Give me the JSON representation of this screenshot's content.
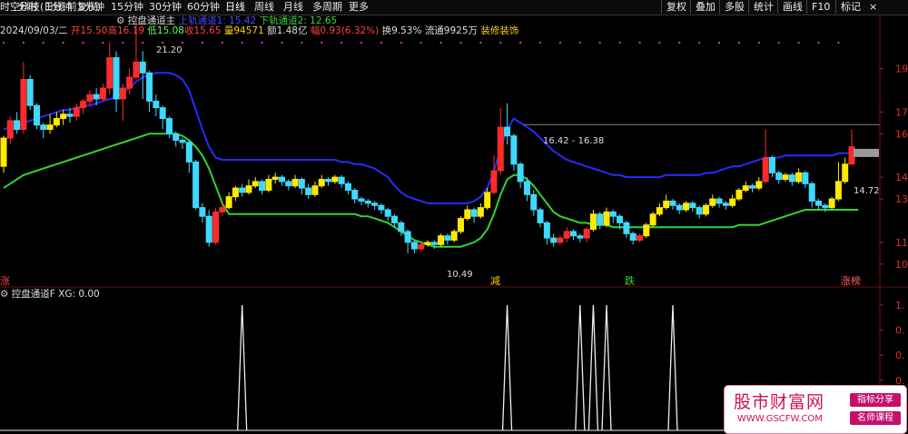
{
  "toolbar": {
    "title_fragment": "时空科技(日线 前复权)",
    "indicator_label": "控盘通道主",
    "periods": [
      "分时",
      "1分钟",
      "5分钟",
      "15分钟",
      "30分钟",
      "60分钟",
      "日线",
      "周线",
      "月线",
      "多周期",
      "更多"
    ],
    "active_period": "日线",
    "right_buttons": [
      "复权",
      "叠加",
      "多股",
      "统计",
      "画线",
      "F10",
      "标记"
    ]
  },
  "header": {
    "upper_channel": "上轨通道1: 15.42",
    "lower_channel": "下轨通道2: 12.65",
    "date": "2024/09/03/二",
    "open": "开15.50",
    "high": "高16.19",
    "low": "低15.08",
    "close": "收15.65",
    "volume": "量94571",
    "amount": "额1.48亿",
    "change": "幅0.93(6.32%)",
    "turnover": "换9.53%",
    "float": "流通9925万",
    "sector": "装修装饰"
  },
  "annotations": {
    "peak": "21.20",
    "trough": "10.49",
    "mid_peak": "16.42 - 16.38",
    "current_price": "14.72",
    "label_jian": "减",
    "label_die": "跌",
    "label_zhangbang": "涨榜",
    "label_left": "涨"
  },
  "price_axis": [
    "19.",
    "17.",
    "16.",
    "14.",
    "13.",
    "11.",
    "10."
  ],
  "sub_panel": {
    "title": "控盘通道F  XG: 0.00",
    "axis": [
      "1.",
      "0.",
      "0.",
      "0.",
      "0.",
      "0."
    ]
  },
  "chart_data": [
    {
      "type": "candlestick",
      "title": "控盘通道主",
      "y_ticks": [
        19,
        17,
        16,
        14,
        13,
        11,
        10
      ],
      "ylim": [
        9.2,
        20.4
      ],
      "grid": false,
      "series": [
        {
          "name": "上轨通道1",
          "values": [
            16.2,
            16.3,
            16.4,
            16.5,
            16.6,
            16.7,
            16.8,
            16.9,
            17.0,
            17.1,
            17.1,
            17.2,
            17.3,
            17.3,
            17.4,
            17.5,
            17.6,
            17.7,
            17.9,
            18.1,
            18.4,
            18.6,
            18.7,
            18.8,
            18.8,
            18.8,
            18.7,
            18.5,
            18.0,
            17.1,
            16.2,
            15.4,
            14.9,
            14.8,
            14.8,
            14.8,
            14.8,
            14.8,
            14.8,
            14.8,
            14.8,
            14.8,
            14.8,
            14.8,
            14.8,
            14.8,
            14.8,
            14.8,
            14.8,
            14.8,
            14.8,
            14.7,
            14.7,
            14.6,
            14.6,
            14.5,
            14.4,
            14.2,
            14.0,
            13.6,
            13.3,
            13.1,
            13.0,
            12.9,
            12.8,
            12.8,
            12.8,
            12.8,
            12.8,
            12.8,
            12.8,
            12.9,
            13.1,
            13.5,
            14.3,
            15.3,
            16.2,
            16.7,
            16.5,
            16.3,
            16.1,
            15.8,
            15.5,
            15.2,
            15.0,
            14.8,
            14.7,
            14.6,
            14.5,
            14.4,
            14.3,
            14.2,
            14.1,
            14.1,
            14.0,
            14.0,
            14.0,
            14.0,
            14.0,
            14.0,
            14.1,
            14.1,
            14.1,
            14.1,
            14.1,
            14.1,
            14.2,
            14.2,
            14.3,
            14.4,
            14.5,
            14.5,
            14.6,
            14.7,
            14.8,
            14.9,
            14.9,
            14.9,
            15.0,
            15.0,
            15.0,
            15.0,
            15.0,
            15.0,
            15.0,
            15.0,
            15.1,
            15.1,
            15.1,
            15.1,
            15.1
          ]
        },
        {
          "name": "下轨通道2",
          "values": [
            13.5,
            13.7,
            13.9,
            14.1,
            14.2,
            14.3,
            14.4,
            14.5,
            14.6,
            14.7,
            14.8,
            14.9,
            15.0,
            15.1,
            15.2,
            15.3,
            15.4,
            15.5,
            15.6,
            15.7,
            15.8,
            15.9,
            16.0,
            16.0,
            16.0,
            16.0,
            16.0,
            15.9,
            15.7,
            15.4,
            15.0,
            14.4,
            13.6,
            12.8,
            12.3,
            12.3,
            12.3,
            12.3,
            12.3,
            12.3,
            12.3,
            12.3,
            12.3,
            12.3,
            12.3,
            12.3,
            12.3,
            12.3,
            12.3,
            12.3,
            12.3,
            12.3,
            12.3,
            12.3,
            12.2,
            12.2,
            12.1,
            12.0,
            11.9,
            11.7,
            11.5,
            11.3,
            11.1,
            11.0,
            10.9,
            10.8,
            10.8,
            10.8,
            10.8,
            10.8,
            10.9,
            11.0,
            11.2,
            11.6,
            12.3,
            13.2,
            13.9,
            14.1,
            14.1,
            13.9,
            13.6,
            13.2,
            12.8,
            12.4,
            12.2,
            12.1,
            12.0,
            11.9,
            11.9,
            11.8,
            11.8,
            11.8,
            11.7,
            11.7,
            11.7,
            11.7,
            11.7,
            11.7,
            11.7,
            11.7,
            11.7,
            11.7,
            11.7,
            11.7,
            11.7,
            11.7,
            11.7,
            11.7,
            11.7,
            11.7,
            11.7,
            11.8,
            11.8,
            11.8,
            11.8,
            11.9,
            12.0,
            12.1,
            12.2,
            12.3,
            12.4,
            12.5,
            12.5,
            12.5,
            12.5,
            12.5,
            12.5,
            12.5,
            12.5,
            12.5
          ]
        }
      ],
      "candles": [
        [
          14.5,
          15.8,
          15.9,
          14.2
        ],
        [
          15.8,
          16.6,
          16.8,
          15.5
        ],
        [
          16.6,
          16.2,
          17.0,
          16.0
        ],
        [
          16.2,
          18.5,
          19.3,
          16.0
        ],
        [
          18.5,
          17.3,
          18.7,
          17.1
        ],
        [
          17.3,
          16.4,
          17.4,
          16.2
        ],
        [
          16.4,
          16.2,
          16.5,
          15.8
        ],
        [
          16.2,
          16.4,
          16.9,
          16.0
        ],
        [
          16.4,
          16.7,
          17.0,
          16.3
        ],
        [
          16.7,
          16.9,
          17.1,
          16.4
        ],
        [
          16.9,
          16.8,
          17.2,
          16.5
        ],
        [
          16.8,
          17.2,
          17.4,
          16.6
        ],
        [
          17.2,
          17.5,
          17.6,
          16.9
        ],
        [
          17.5,
          17.8,
          18.0,
          17.3
        ],
        [
          17.8,
          17.6,
          18.1,
          17.3
        ],
        [
          17.6,
          18.1,
          18.3,
          17.5
        ],
        [
          18.1,
          19.5,
          20.2,
          17.8
        ],
        [
          19.5,
          17.6,
          19.8,
          17.0
        ],
        [
          17.6,
          18.1,
          18.3,
          16.6
        ],
        [
          18.1,
          18.6,
          19.0,
          17.8
        ],
        [
          18.6,
          19.3,
          21.2,
          18.5
        ],
        [
          19.3,
          18.8,
          19.8,
          17.6
        ],
        [
          18.8,
          17.5,
          18.9,
          17.0
        ],
        [
          17.5,
          17.2,
          17.8,
          16.8
        ],
        [
          17.2,
          16.7,
          17.3,
          16.2
        ],
        [
          16.7,
          16.0,
          16.8,
          15.8
        ],
        [
          16.0,
          15.7,
          16.1,
          15.4
        ],
        [
          15.7,
          15.6,
          15.8,
          15.3
        ],
        [
          15.6,
          14.7,
          15.7,
          14.2
        ],
        [
          14.7,
          12.6,
          14.8,
          12.5
        ],
        [
          12.6,
          12.2,
          12.8,
          11.9
        ],
        [
          12.2,
          11.0,
          12.5,
          10.8
        ],
        [
          11.0,
          12.4,
          12.6,
          10.9
        ],
        [
          12.4,
          12.6,
          12.8,
          12.2
        ],
        [
          12.6,
          13.1,
          13.3,
          12.5
        ],
        [
          13.1,
          13.5,
          13.6,
          12.9
        ],
        [
          13.5,
          13.3,
          13.7,
          13.1
        ],
        [
          13.3,
          13.6,
          13.9,
          13.2
        ],
        [
          13.6,
          13.8,
          14.0,
          13.5
        ],
        [
          13.8,
          13.4,
          13.9,
          13.2
        ],
        [
          13.4,
          13.9,
          14.1,
          13.3
        ],
        [
          13.9,
          14.0,
          14.2,
          13.7
        ],
        [
          14.0,
          13.8,
          14.1,
          13.6
        ],
        [
          13.8,
          13.6,
          13.9,
          13.4
        ],
        [
          13.6,
          13.9,
          14.1,
          13.5
        ],
        [
          13.9,
          13.5,
          14.0,
          13.2
        ],
        [
          13.5,
          13.2,
          13.7,
          13.0
        ],
        [
          13.2,
          13.6,
          13.8,
          13.1
        ],
        [
          13.6,
          13.9,
          14.1,
          13.5
        ],
        [
          13.9,
          13.8,
          14.0,
          13.6
        ],
        [
          13.8,
          14.0,
          14.1,
          13.7
        ],
        [
          14.0,
          13.7,
          14.1,
          13.5
        ],
        [
          13.7,
          13.4,
          13.8,
          13.2
        ],
        [
          13.4,
          13.0,
          13.5,
          12.8
        ],
        [
          13.0,
          12.9,
          13.1,
          12.7
        ],
        [
          12.9,
          12.8,
          13.0,
          12.6
        ],
        [
          12.8,
          12.7,
          12.9,
          12.5
        ],
        [
          12.7,
          12.5,
          12.8,
          12.3
        ],
        [
          12.5,
          12.2,
          12.6,
          12.0
        ],
        [
          12.2,
          11.9,
          12.3,
          11.7
        ],
        [
          11.9,
          11.5,
          12.0,
          11.3
        ],
        [
          11.5,
          11.0,
          11.6,
          10.5
        ],
        [
          11.0,
          10.7,
          11.1,
          10.5
        ],
        [
          10.7,
          10.9,
          11.0,
          10.6
        ],
        [
          10.9,
          11.0,
          11.1,
          10.8
        ],
        [
          11.0,
          10.9,
          11.1,
          10.7
        ],
        [
          10.9,
          11.3,
          11.4,
          10.8
        ],
        [
          11.3,
          11.1,
          11.4,
          10.9
        ],
        [
          11.1,
          11.5,
          11.6,
          11.0
        ],
        [
          11.5,
          12.1,
          12.2,
          11.4
        ],
        [
          12.1,
          12.5,
          12.7,
          12.0
        ],
        [
          12.5,
          12.2,
          12.6,
          11.9
        ],
        [
          12.2,
          12.6,
          12.8,
          12.1
        ],
        [
          12.6,
          13.3,
          13.5,
          12.5
        ],
        [
          13.3,
          14.3,
          15.0,
          13.2
        ],
        [
          14.3,
          16.3,
          17.2,
          14.1
        ],
        [
          16.3,
          15.9,
          17.4,
          15.5
        ],
        [
          15.9,
          14.6,
          16.0,
          14.3
        ],
        [
          14.6,
          13.8,
          14.7,
          13.5
        ],
        [
          13.8,
          13.2,
          14.0,
          12.9
        ],
        [
          13.2,
          12.5,
          13.4,
          12.2
        ],
        [
          12.5,
          11.9,
          12.6,
          11.7
        ],
        [
          11.9,
          11.2,
          12.0,
          10.9
        ],
        [
          11.2,
          11.0,
          11.4,
          10.8
        ],
        [
          11.0,
          11.2,
          11.3,
          10.9
        ],
        [
          11.2,
          11.5,
          11.7,
          11.0
        ],
        [
          11.5,
          11.3,
          11.6,
          11.1
        ],
        [
          11.3,
          11.2,
          11.4,
          11.0
        ],
        [
          11.2,
          11.6,
          11.7,
          11.0
        ],
        [
          11.6,
          12.3,
          12.5,
          11.5
        ],
        [
          12.3,
          11.8,
          12.4,
          11.6
        ],
        [
          11.8,
          12.4,
          12.6,
          11.7
        ],
        [
          12.4,
          12.2,
          12.5,
          11.9
        ],
        [
          12.2,
          11.9,
          12.3,
          11.6
        ],
        [
          11.9,
          11.4,
          12.0,
          11.2
        ],
        [
          11.4,
          11.1,
          11.5,
          10.9
        ],
        [
          11.1,
          11.3,
          11.4,
          11.0
        ],
        [
          11.3,
          11.8,
          11.9,
          11.2
        ],
        [
          11.8,
          12.3,
          12.4,
          11.7
        ],
        [
          12.3,
          12.6,
          12.8,
          12.2
        ],
        [
          12.6,
          12.9,
          13.2,
          12.5
        ],
        [
          12.9,
          12.7,
          13.0,
          12.5
        ],
        [
          12.7,
          12.5,
          12.8,
          12.3
        ],
        [
          12.5,
          12.8,
          12.9,
          12.4
        ],
        [
          12.8,
          12.6,
          12.9,
          12.4
        ],
        [
          12.6,
          12.3,
          12.7,
          12.1
        ],
        [
          12.3,
          12.7,
          12.8,
          12.2
        ],
        [
          12.7,
          13.0,
          13.2,
          12.6
        ],
        [
          13.0,
          12.8,
          13.1,
          12.6
        ],
        [
          12.8,
          12.7,
          12.9,
          12.5
        ],
        [
          12.7,
          13.0,
          13.2,
          12.6
        ],
        [
          13.0,
          13.4,
          13.5,
          12.9
        ],
        [
          13.4,
          13.6,
          13.8,
          13.3
        ],
        [
          13.6,
          13.5,
          13.7,
          13.3
        ],
        [
          13.5,
          13.8,
          14.0,
          13.4
        ],
        [
          13.8,
          14.9,
          16.2,
          13.7
        ],
        [
          14.9,
          14.2,
          15.0,
          14.0
        ],
        [
          14.2,
          13.9,
          14.3,
          13.7
        ],
        [
          13.9,
          14.1,
          14.2,
          13.8
        ],
        [
          14.1,
          13.8,
          14.2,
          13.6
        ],
        [
          13.8,
          14.2,
          14.4,
          13.7
        ],
        [
          14.2,
          13.7,
          14.3,
          13.5
        ],
        [
          13.7,
          12.9,
          13.8,
          12.6
        ],
        [
          12.9,
          12.7,
          13.0,
          12.5
        ],
        [
          12.7,
          12.6,
          12.8,
          12.4
        ],
        [
          12.6,
          13.0,
          13.1,
          12.5
        ],
        [
          13.0,
          13.8,
          14.7,
          12.9
        ],
        [
          13.8,
          14.6,
          14.9,
          13.7
        ],
        [
          14.6,
          15.4,
          16.2,
          15.1
        ]
      ]
    },
    {
      "type": "line",
      "title": "控盘通道F",
      "series": [
        {
          "name": "XG",
          "values": [
            0,
            0,
            0,
            0,
            0,
            0,
            0,
            0,
            0,
            0,
            0,
            0,
            0,
            0,
            0,
            0,
            0,
            0,
            0,
            0,
            0,
            0,
            0,
            0,
            0,
            0,
            0,
            0,
            0,
            0,
            0,
            0,
            0,
            0,
            0,
            0,
            1,
            0,
            0,
            0,
            0,
            0,
            0,
            0,
            0,
            0,
            0,
            0,
            0,
            0,
            0,
            0,
            0,
            0,
            0,
            0,
            0,
            0,
            0,
            0,
            0,
            0,
            0,
            0,
            0,
            0,
            0,
            0,
            0,
            0,
            0,
            0,
            0,
            0,
            0,
            0,
            0,
            0,
            0,
            0,
            0,
            0,
            0,
            0,
            0,
            0,
            0,
            0,
            0,
            1,
            0,
            0,
            0,
            0,
            0,
            0,
            0,
            0,
            0,
            0,
            0,
            0,
            0,
            0,
            0,
            0,
            0,
            0,
            0,
            0,
            0,
            0,
            0,
            0,
            0,
            0,
            0,
            0,
            0,
            0,
            0,
            0,
            0,
            0,
            0,
            0,
            0,
            0,
            0,
            0,
            0
          ]
        }
      ],
      "ylim": [
        0,
        1
      ]
    }
  ],
  "logo": {
    "name": "股市财富网",
    "url": "WWW.GSCFW.COM",
    "tag1": "指标分享",
    "tag2": "名师课程"
  }
}
